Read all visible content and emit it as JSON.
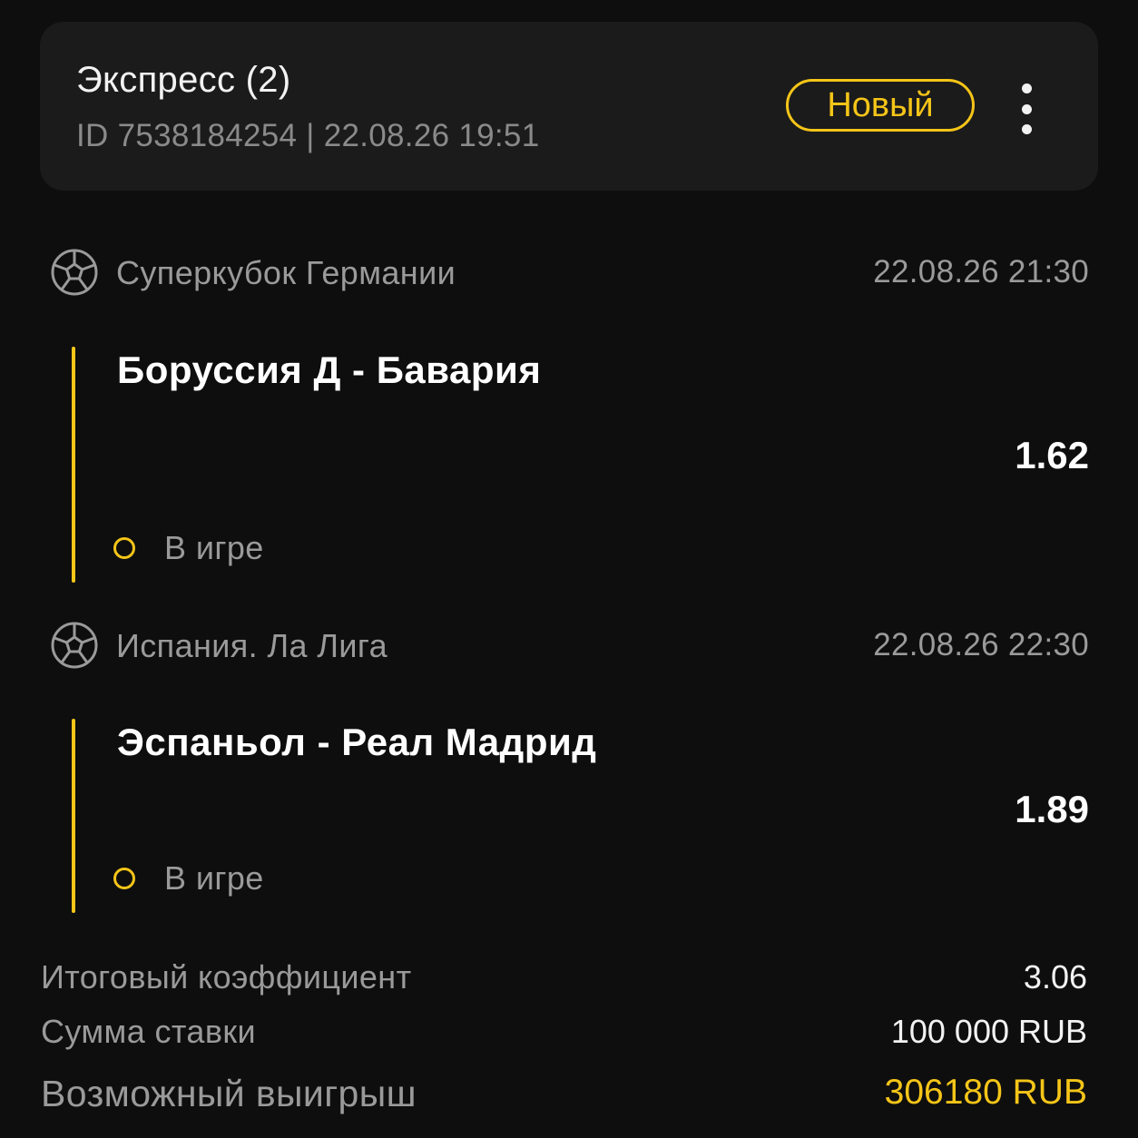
{
  "header": {
    "title": "Экспресс (2)",
    "subtitle": "ID 7538184254 | 22.08.26 19:51",
    "status_badge": "Новый",
    "more_icon": "more-vertical-icon"
  },
  "events": [
    {
      "league": "Суперкубок Германии",
      "datetime": "22.08.26 21:30",
      "match": "Боруссия Д - Бавария",
      "odds": "1.62",
      "status": "В игре",
      "icon": "soccer-ball-icon"
    },
    {
      "league": "Испания. Ла Лига",
      "datetime": "22.08.26 22:30",
      "match": "Эспаньол - Реал Мадрид",
      "odds": "1.89",
      "status": "В игре",
      "icon": "soccer-ball-icon"
    }
  ],
  "summary": {
    "total_odds_label": "Итоговый коэффициент",
    "total_odds_value": "3.06",
    "stake_label": "Сумма ставки",
    "stake_value": "100 000 RUB",
    "payout_label": "Возможный выигрыш",
    "payout_value": "306180 RUB"
  },
  "colors": {
    "background": "#0e0e0e",
    "card": "#1b1b1b",
    "accent": "#f5c518",
    "text_primary": "#ffffff",
    "text_secondary": "#9a9a9a"
  }
}
